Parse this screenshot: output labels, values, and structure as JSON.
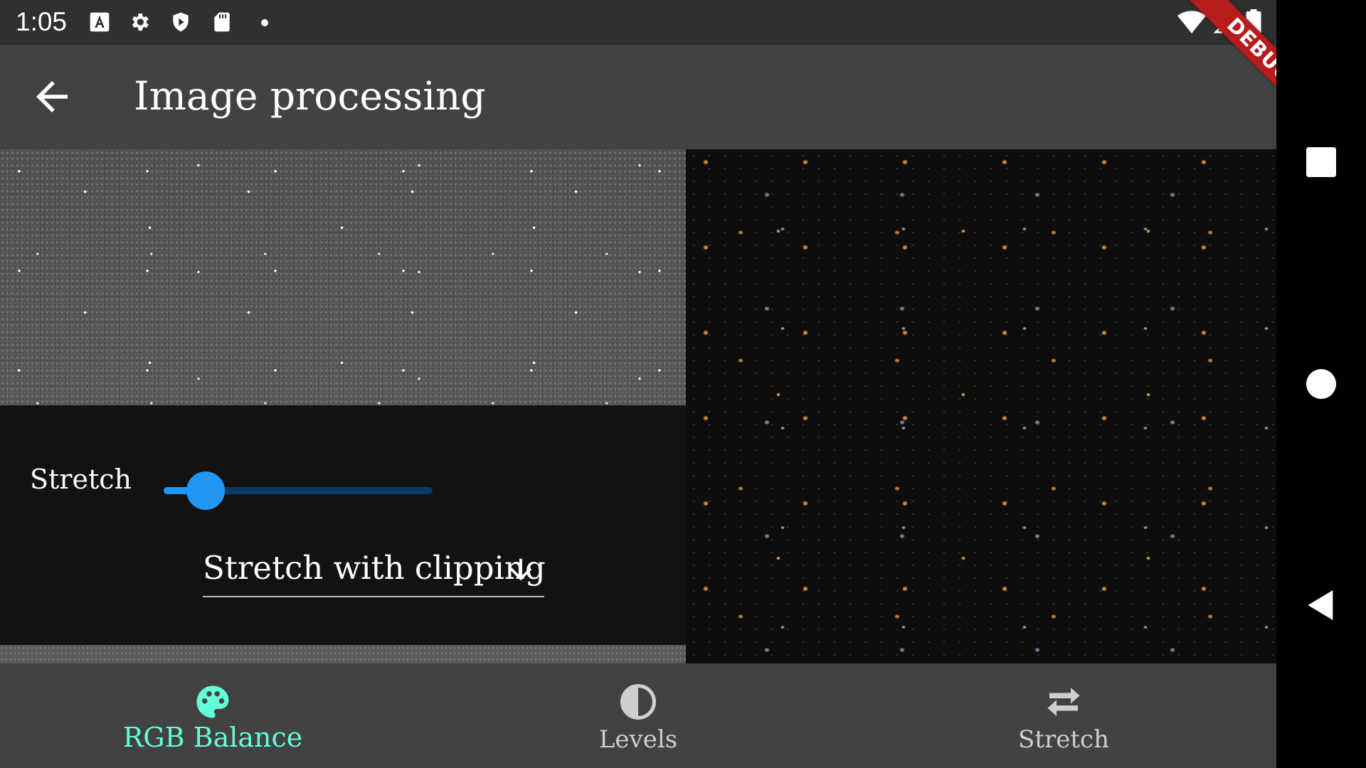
{
  "status_bar": {
    "time": "1:05",
    "icons": [
      "font-a-icon",
      "gear-icon",
      "shield-play-icon",
      "sd-card-icon",
      "notification-dot-icon",
      "wifi-icon",
      "signal-icon",
      "battery-icon"
    ]
  },
  "debug_banner": "DEBUG",
  "app_bar": {
    "title": "Image processing",
    "back_icon": "arrow-back-icon"
  },
  "controls": {
    "stretch_label": "Stretch",
    "slider_value": 0.14,
    "dropdown_value": "Stretch with clipping",
    "dropdown_icon": "arrow-down-icon"
  },
  "bottom_nav": {
    "items": [
      {
        "label": "RGB Balance",
        "icon": "palette-icon",
        "active": true
      },
      {
        "label": "Levels",
        "icon": "contrast-icon",
        "active": false
      },
      {
        "label": "Stretch",
        "icon": "swap-arrows-icon",
        "active": false
      }
    ]
  },
  "colors": {
    "accent": "#64ffda",
    "slider": "#2196f3",
    "app_bar": "#424242",
    "debug": "#b71c1c"
  },
  "system_nav": {
    "buttons": [
      "recents-square-icon",
      "home-circle-icon",
      "back-triangle-icon"
    ]
  }
}
